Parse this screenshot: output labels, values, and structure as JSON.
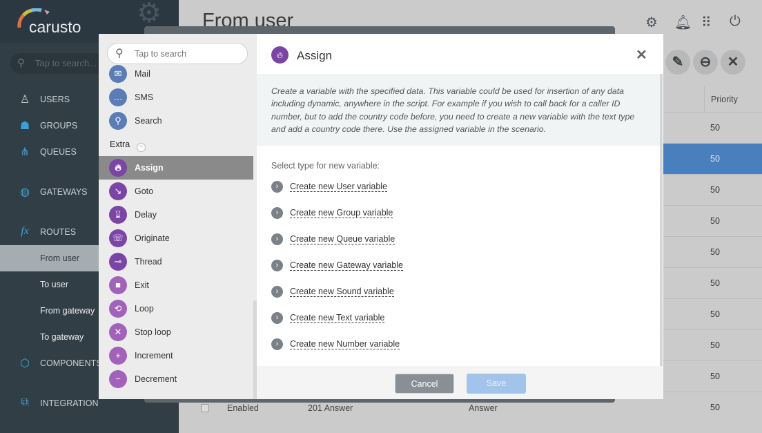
{
  "app": {
    "logo": "carusto",
    "search_placeholder": "Tap to search..."
  },
  "sidebar": {
    "items": [
      {
        "label": "USERS",
        "icon": "user-icon"
      },
      {
        "label": "GROUPS",
        "icon": "group-icon"
      },
      {
        "label": "QUEUES",
        "icon": "queue-icon"
      },
      {
        "label": "GATEWAYS",
        "icon": "globe-icon"
      },
      {
        "label": "ROUTES",
        "icon": "function-icon"
      },
      {
        "label": "From user"
      },
      {
        "label": "To user"
      },
      {
        "label": "From gateway"
      },
      {
        "label": "To gateway"
      },
      {
        "label": "COMPONENTS",
        "icon": "cube-icon"
      },
      {
        "label": "INTEGRATION",
        "icon": "integration-icon"
      }
    ]
  },
  "main": {
    "title": "From user",
    "priority_header": "Priority",
    "priorities": [
      "50",
      "50",
      "50",
      "50",
      "50",
      "50",
      "50",
      "50",
      "50",
      "50"
    ],
    "last_row": {
      "status": "Enabled",
      "name": "201 Answer",
      "action": "Answer"
    }
  },
  "modal": {
    "search_placeholder": "Tap to search",
    "actions_top": [
      "Mail",
      "SMS",
      "Search"
    ],
    "section": "Extra",
    "actions": [
      "Assign",
      "Goto",
      "Delay",
      "Originate",
      "Thread",
      "Exit",
      "Loop",
      "Stop loop",
      "Increment",
      "Decrement"
    ],
    "selected": "Assign",
    "title": "Assign",
    "description": "Create a variable with the specified data. This variable could be used for insertion of any data including dynamic, anywhere in the script. For example if you wish to call back for a caller ID number, but to add the country code before, you need to create a new variable with the text type and add a country code there. Use the assigned variable in the scenario.",
    "select_label": "Select type for new variable:",
    "options": [
      "Create new User variable",
      "Create new Group variable",
      "Create new Queue variable",
      "Create new Gateway variable",
      "Create new Sound variable",
      "Create new Text variable",
      "Create new Number variable"
    ],
    "cancel": "Cancel",
    "save": "Save"
  },
  "colors": {
    "sidebar": "#323e46",
    "accent_purple": "#7b45a6",
    "accent_blue": "#5b7db5",
    "selected_row": "#4a7fbd"
  }
}
